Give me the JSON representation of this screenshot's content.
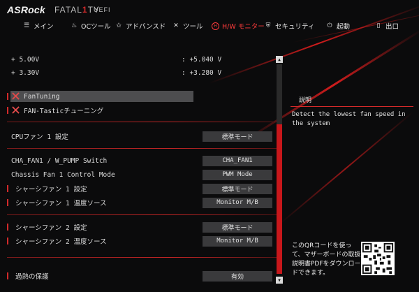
{
  "brand": {
    "logo": "ASRock",
    "series_pre": "FATAL",
    "series_one": "1",
    "series_post": "TY",
    "suffix": "UEFI"
  },
  "menu": [
    {
      "label": "メイン",
      "icon": "list-icon"
    },
    {
      "label": "OCツール",
      "icon": "flame-icon"
    },
    {
      "label": "アドバンスド",
      "icon": "star-icon"
    },
    {
      "label": "ツール",
      "icon": "tools-icon"
    },
    {
      "label": "H/W モニター",
      "icon": "hw-monitor-icon",
      "active": true
    },
    {
      "label": "セキュリティ",
      "icon": "shield-icon"
    },
    {
      "label": "起動",
      "icon": "power-icon"
    },
    {
      "label": "出口",
      "icon": "exit-icon"
    }
  ],
  "voltages": [
    {
      "label": "+ 5.00V",
      "value": ": +5.040 V"
    },
    {
      "label": "+ 3.30V",
      "value": ": +3.280 V"
    }
  ],
  "fan_tools": [
    {
      "label": "FanTuning",
      "selected": true
    },
    {
      "label": "FAN-Tasticチューニング",
      "selected": false
    }
  ],
  "settings": {
    "cpu_fan1": {
      "label": "CPUファン 1 設定",
      "value": "標準モード"
    },
    "cha_fan1_pump": {
      "label": "CHA_FAN1 / W_PUMP Switch",
      "value": "CHA_FAN1"
    },
    "chassis_fan1_ctrl": {
      "label": "Chassis Fan 1 Control Mode",
      "value": "PWM Mode"
    },
    "chassis_fan1": {
      "label": "シャーシファン 1 設定",
      "value": "標準モード"
    },
    "chassis_fan1_temp": {
      "label": "シャーシファン 1 温度ソース",
      "value": "Monitor M/B"
    },
    "chassis_fan2": {
      "label": "シャーシファン 2 設定",
      "value": "標準モード"
    },
    "chassis_fan2_temp": {
      "label": "シャーシファン 2 温度ソース",
      "value": "Monitor M/B"
    },
    "overheat": {
      "label": "過熱の保護",
      "value": "有効"
    }
  },
  "description": {
    "title": "説明",
    "text": "Detect the lowest fan speed in the system"
  },
  "qr_note": "このQRコードを使って、マザーボードの取扱説明書PDFをダウンロードできます。",
  "colors": {
    "accent": "#d42a2a",
    "scroll_thumb": "#c8171b",
    "button_bg": "#3a3a3c"
  }
}
